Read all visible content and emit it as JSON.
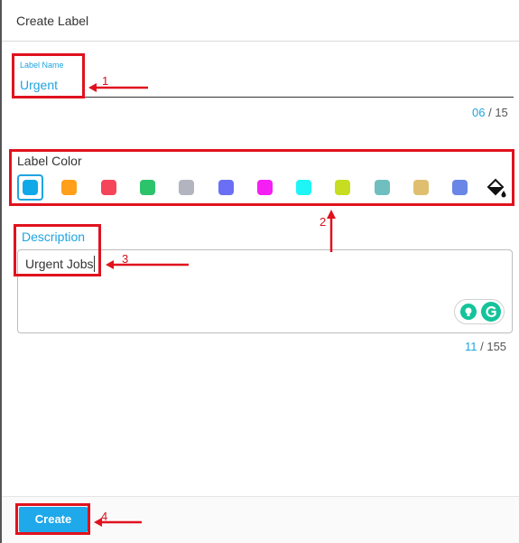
{
  "header": {
    "title": "Create Label"
  },
  "label_name": {
    "label": "Label Name",
    "value": "Urgent",
    "count_current": "06",
    "count_max": "/ 15"
  },
  "label_color": {
    "title": "Label Color",
    "swatches": [
      "#0fa8e9",
      "#ff9f1a",
      "#f5455b",
      "#2cc36b",
      "#b2b5bf",
      "#6a6ff5",
      "#f51ff5",
      "#1ff5f5",
      "#c6dd21",
      "#6fbfbf",
      "#dfbf6f",
      "#6a86e6"
    ],
    "selected_index": 0,
    "custom_icon": "paint-bucket-icon"
  },
  "description": {
    "label": "Description",
    "value": "Urgent Jobs",
    "count_current": "11",
    "count_max": "/ 155"
  },
  "grammarly": {
    "icons": [
      "lightbulb-icon",
      "grammarly-g-icon"
    ]
  },
  "footer": {
    "create_label": "Create"
  },
  "annotations": {
    "n1": "1",
    "n2": "2",
    "n3": "3",
    "n4": "4"
  }
}
